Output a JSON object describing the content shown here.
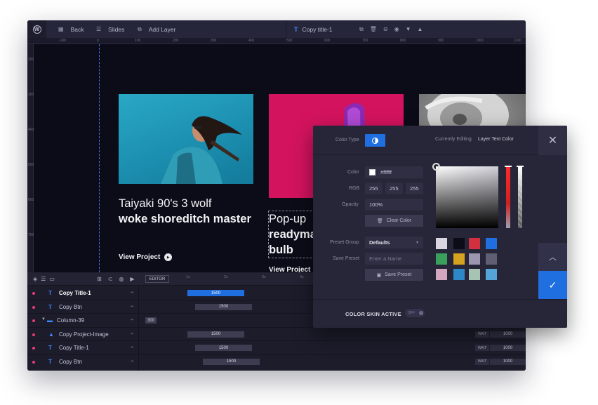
{
  "toolbar": {
    "back_label": "Back",
    "slides_label": "Slides",
    "add_layer_label": "Add Layer",
    "current_layer": "Copy  title-1"
  },
  "ruler": {
    "h_ticks": [
      "-100",
      "0",
      "100",
      "200",
      "300",
      "400",
      "500",
      "600",
      "700",
      "800",
      "900",
      "1000",
      "1100"
    ],
    "v_ticks": [
      "200",
      "300",
      "400",
      "500",
      "600",
      "700",
      "800"
    ]
  },
  "canvas": {
    "card1": {
      "title_light": "Taiyaki 90's 3 wolf",
      "title_bold": "woke shoreditch master",
      "link": "View Project"
    },
    "card2": {
      "title_light": "Pop-up",
      "title_bold": "readymade bulb",
      "link": "View Project"
    }
  },
  "timeline": {
    "editor_label": "EDITOR",
    "scale": [
      "1s",
      "2s",
      "3s",
      "4s"
    ],
    "rows": [
      {
        "name": "Copy Title-1",
        "icon": "T",
        "bar": "1500",
        "active": true,
        "wait": false
      },
      {
        "name": "Copy Btn",
        "icon": "T",
        "bar": "1500",
        "active": false,
        "wait": false
      },
      {
        "name": "Column-39",
        "icon": "▬",
        "bar": "300",
        "active": false,
        "wait": false
      },
      {
        "name": "Copy Project-Image",
        "icon": "▲",
        "bar": "1500",
        "active": false,
        "wait": true,
        "wait_label": "WAIT",
        "wait_value": "1000"
      },
      {
        "name": "Copy Title-1",
        "icon": "T",
        "bar": "1500",
        "active": false,
        "wait": true,
        "wait_label": "WAIT",
        "wait_value": "1000"
      },
      {
        "name": "Copy Btn",
        "icon": "T",
        "bar": "1500",
        "active": false,
        "wait": true,
        "wait_label": "WAIT",
        "wait_value": "1000"
      }
    ]
  },
  "color_panel": {
    "color_type_label": "Color Type",
    "editing_label": "Currently Editing",
    "editing_value": "Layer Text Color",
    "color_label": "Color",
    "color_value": "#ffffff",
    "rgb_label": "RGB",
    "rgb": [
      "255",
      "255",
      "255"
    ],
    "opacity_label": "Opacity",
    "opacity_value": "100%",
    "clear_label": "Clear Color",
    "preset_group_label": "Preset Group",
    "preset_group_value": "Defaults",
    "save_preset_label": "Save Preset",
    "save_preset_placeholder": "Enter a Name",
    "save_preset_button": "Save Preset",
    "skin_label": "COLOR SKIN ACTIVE",
    "skin_toggle": "OFF",
    "swatches": [
      "#d9d6e0",
      "#0c0b18",
      "#d2303e",
      "#1f6fe0",
      "#3aa05c",
      "#d6a320",
      "#9c96b0",
      "#5e5f72",
      "#d5a6c0",
      "#2e87c7",
      "#a7c3b4",
      "#54a4d6"
    ]
  },
  "colors": {
    "accent": "#1f6fe0",
    "dot": "#ea3a73"
  }
}
